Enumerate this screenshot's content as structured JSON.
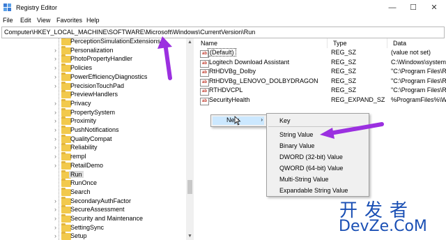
{
  "window": {
    "title": "Registry Editor",
    "min_glyph": "—",
    "max_glyph": "☐",
    "close_glyph": "✕",
    "icon": "registry-editor-icon"
  },
  "menu": [
    "File",
    "Edit",
    "View",
    "Favorites",
    "Help"
  ],
  "address": "Computer\\HKEY_LOCAL_MACHINE\\SOFTWARE\\Microsoft\\Windows\\CurrentVersion\\Run",
  "tree": [
    {
      "label": "PerceptionSimulationExtensions",
      "expandable": false
    },
    {
      "label": "Personalization",
      "expandable": true
    },
    {
      "label": "PhotoPropertyHandler",
      "expandable": true
    },
    {
      "label": "Policies",
      "expandable": true
    },
    {
      "label": "PowerEfficiencyDiagnostics",
      "expandable": true
    },
    {
      "label": "PrecisionTouchPad",
      "expandable": true
    },
    {
      "label": "PreviewHandlers",
      "expandable": false
    },
    {
      "label": "Privacy",
      "expandable": true
    },
    {
      "label": "PropertySystem",
      "expandable": true
    },
    {
      "label": "Proximity",
      "expandable": true
    },
    {
      "label": "PushNotifications",
      "expandable": true
    },
    {
      "label": "QualityCompat",
      "expandable": true
    },
    {
      "label": "Reliability",
      "expandable": true
    },
    {
      "label": "rempl",
      "expandable": true
    },
    {
      "label": "RetailDemo",
      "expandable": true
    },
    {
      "label": "Run",
      "expandable": false,
      "selected": true
    },
    {
      "label": "RunOnce",
      "expandable": false
    },
    {
      "label": "Search",
      "expandable": false
    },
    {
      "label": "SecondaryAuthFactor",
      "expandable": true
    },
    {
      "label": "SecureAssessment",
      "expandable": true
    },
    {
      "label": "Security and Maintenance",
      "expandable": true
    },
    {
      "label": "SettingSync",
      "expandable": true
    },
    {
      "label": "Setup",
      "expandable": true
    }
  ],
  "columns": {
    "name": "Name",
    "type": "Type",
    "data": "Data"
  },
  "values": [
    {
      "name": "(Default)",
      "type": "REG_SZ",
      "data": "(value not set)",
      "boxed": true
    },
    {
      "name": "Logitech Download Assistant",
      "type": "REG_SZ",
      "data": "C:\\Windows\\system"
    },
    {
      "name": "RtHDVBg_Dolby",
      "type": "REG_SZ",
      "data": "\"C:\\Program Files\\Re"
    },
    {
      "name": "RtHDVBg_LENOVO_DOLBYDRAGON",
      "type": "REG_SZ",
      "data": "\"C:\\Program Files\\Re"
    },
    {
      "name": "RTHDVCPL",
      "type": "REG_SZ",
      "data": "\"C:\\Program Files\\Re"
    },
    {
      "name": "SecurityHealth",
      "type": "REG_EXPAND_SZ",
      "data": "%ProgramFiles%\\Wi"
    }
  ],
  "context_menu": {
    "label": "New",
    "arrow": "›"
  },
  "submenu": [
    "Key",
    "String Value",
    "Binary Value",
    "DWORD (32-bit) Value",
    "QWORD (64-bit) Value",
    "Multi-String Value",
    "Expandable String Value"
  ],
  "watermark": {
    "cn": "开发者",
    "en": "DevZe.CoM"
  },
  "colors": {
    "arrow": "#9b30e0",
    "menu_highlight": "#cce8ff",
    "folder": "#f2c94c",
    "watermark": "#1a4fb4"
  }
}
